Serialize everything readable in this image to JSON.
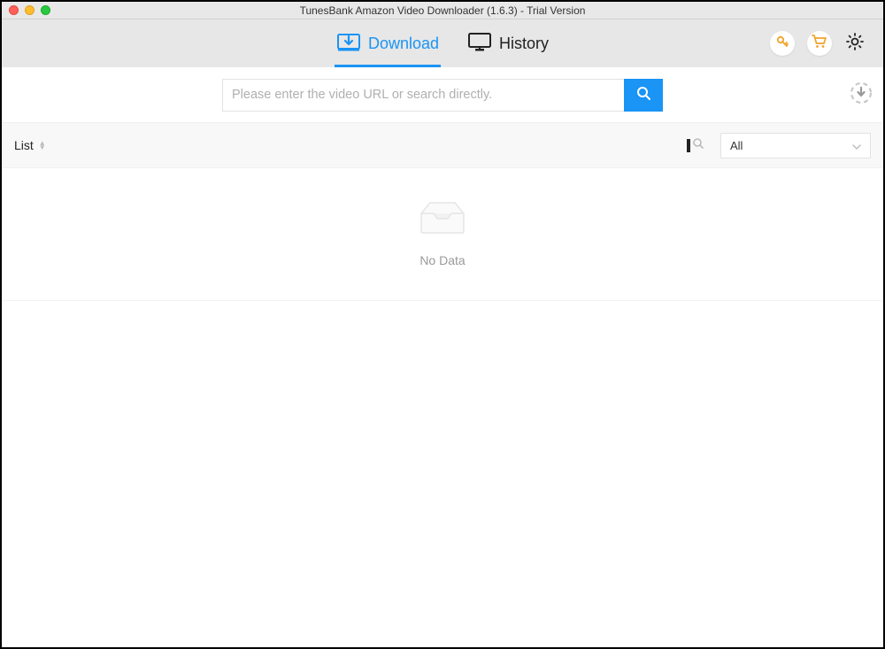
{
  "window": {
    "title": "TunesBank Amazon Video Downloader (1.6.3) - Trial Version"
  },
  "tabs": {
    "download": "Download",
    "history": "History"
  },
  "search": {
    "placeholder": "Please enter the video URL or search directly."
  },
  "list": {
    "label": "List",
    "filter_selected": "All",
    "empty": "No Data"
  },
  "icons": {
    "key": "key-icon",
    "cart": "cart-icon",
    "gear": "gear-icon",
    "download": "download-icon",
    "monitor": "monitor-icon",
    "search": "search-icon",
    "download_progress": "download-progress-icon",
    "small_search": "small-search-icon",
    "chevron_down": "chevron-down-icon",
    "inbox": "inbox-icon",
    "sort": "sort-icon"
  },
  "colors": {
    "accent": "#1a94f5",
    "gold": "#f2a327"
  }
}
